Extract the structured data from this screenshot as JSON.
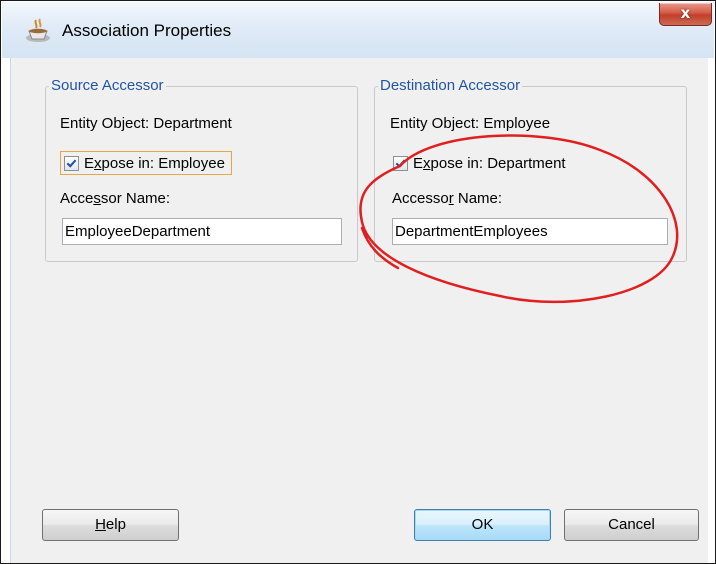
{
  "window": {
    "title": "Association Properties",
    "close_label": "x"
  },
  "source": {
    "group_title": "Source Accessor",
    "entity_label": "Entity Object: Department",
    "expose_pre": "E",
    "expose_mnemonic": "x",
    "expose_post": "pose in: Employee",
    "expose_checked": true,
    "accessor_pre": "Acce",
    "accessor_mnemonic": "s",
    "accessor_post": "sor Name:",
    "accessor_value": "EmployeeDepartment"
  },
  "destination": {
    "group_title": "Destination Accessor",
    "entity_label": "Entity Object: Employee",
    "expose_pre": "E",
    "expose_mnemonic": "x",
    "expose_post": "pose in: Department",
    "expose_checked": true,
    "accessor_pre": "Accesso",
    "accessor_mnemonic": "r",
    "accessor_post": " Name:",
    "accessor_value": "DepartmentEmployees"
  },
  "buttons": {
    "help_mnemonic": "H",
    "help_rest": "elp",
    "ok": "OK",
    "cancel": "Cancel"
  },
  "annotation": {
    "color": "#e02020"
  }
}
